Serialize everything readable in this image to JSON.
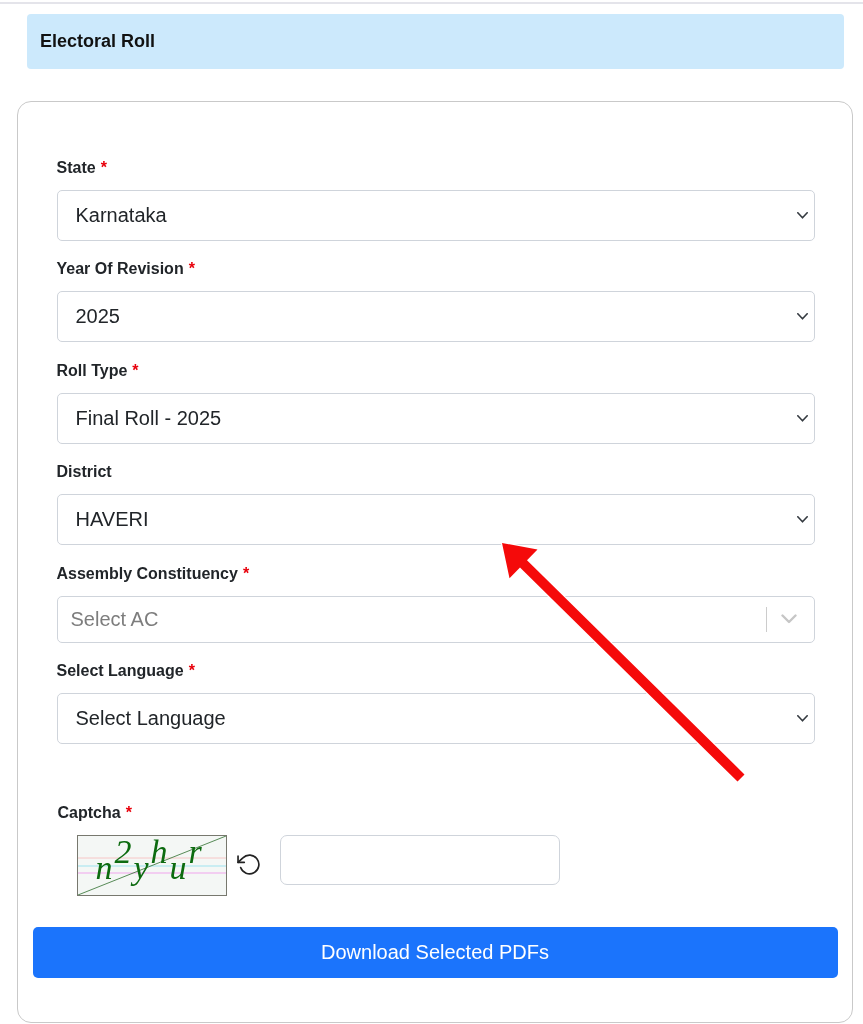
{
  "page_title": "Electoral Roll",
  "form": {
    "required_mark": "*",
    "fields": [
      {
        "kind": "select",
        "label": "State",
        "required": true,
        "value": "Karnataka"
      },
      {
        "kind": "select",
        "label": "Year Of Revision",
        "required": true,
        "value": "2025"
      },
      {
        "kind": "select",
        "label": "Roll Type",
        "required": true,
        "value": "Final Roll - 2025"
      },
      {
        "kind": "select",
        "label": "District",
        "required": false,
        "value": "HAVERI"
      },
      {
        "kind": "combobox",
        "label": "Assembly Constituency",
        "required": true,
        "placeholder": "Select AC"
      },
      {
        "kind": "select",
        "label": "Select Language",
        "required": true,
        "value": "Select Language"
      }
    ],
    "captcha": {
      "label": "Captcha",
      "required": true,
      "image_text": "n$^{2}$y$^{h}$u$^{r}$"
    },
    "submit_button": "Download Selected PDFs"
  },
  "annotations": [
    {
      "kind": "arrow"
    }
  ]
}
